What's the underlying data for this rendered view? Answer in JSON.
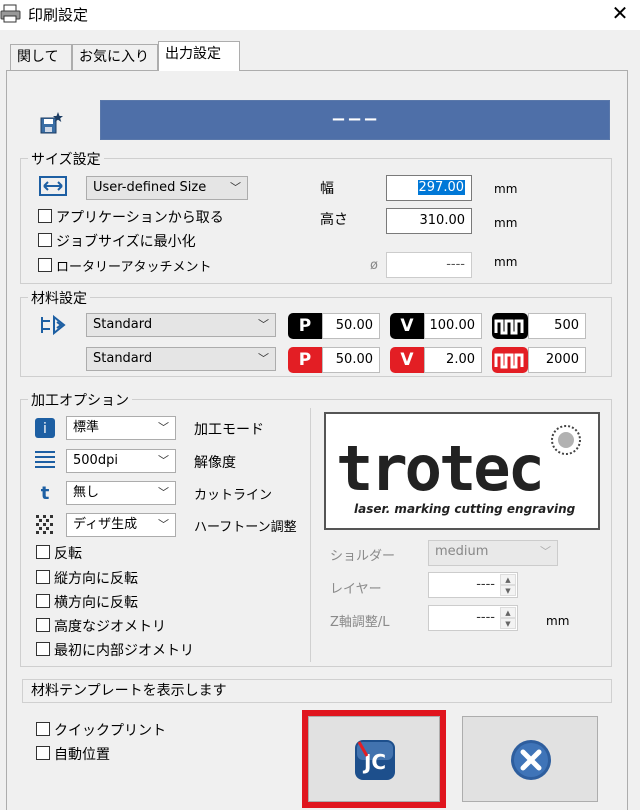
{
  "window": {
    "title": "印刷設定",
    "close_icon": "close-icon"
  },
  "tabs": [
    {
      "label": "関して"
    },
    {
      "label": "お気に入り"
    },
    {
      "label": "出力設定",
      "active": true
    }
  ],
  "banner": {
    "text": "−−−"
  },
  "size_group": {
    "title": "サイズ設定",
    "size_select": "User-defined Size",
    "width_label": "幅",
    "width_value": "297.00",
    "height_label": "高さ",
    "height_value": "310.00",
    "diameter_label": "ø",
    "diameter_value": "----",
    "unit": "mm",
    "checkboxes": [
      {
        "label": "アプリケーションから取る",
        "checked": false
      },
      {
        "label": "ジョブサイズに最小化",
        "checked": false
      },
      {
        "label": "ロータリーアタッチメント",
        "checked": false
      }
    ]
  },
  "material_group": {
    "title": "材料設定",
    "rows": [
      {
        "select": "Standard",
        "p": "50.00",
        "v": "100.00",
        "f": "500",
        "color": "#000000"
      },
      {
        "select": "Standard",
        "p": "50.00",
        "v": "2.00",
        "f": "2000",
        "color": "#e31e24"
      }
    ],
    "badge_p": "P",
    "badge_v": "V"
  },
  "options_group": {
    "title": "加工オプション",
    "rows": [
      {
        "value": "標準",
        "label": "加工モード"
      },
      {
        "value": "500dpi",
        "label": "解像度"
      },
      {
        "value": "無し",
        "label": "カットライン"
      },
      {
        "value": "ディザ生成",
        "label": "ハーフトーン調整"
      }
    ],
    "checkboxes": [
      {
        "label": "反転",
        "checked": false
      },
      {
        "label": "縦方向に反転",
        "checked": false
      },
      {
        "label": "横方向に反転",
        "checked": false
      },
      {
        "label": "高度なジオメトリ",
        "checked": false
      },
      {
        "label": "最初に内部ジオメトリ",
        "checked": false
      }
    ],
    "logo_word": "trotec",
    "logo_tagline": "laser. marking cutting engraving",
    "shoulder_label": "ショルダー",
    "shoulder_value": "medium",
    "layer_label": "レイヤー",
    "layer_value": "----",
    "zaxis_label": "Z軸調整/L",
    "zaxis_value": "----",
    "zaxis_unit": "mm"
  },
  "template_bar": {
    "label": "材料テンプレートを表示します"
  },
  "bottom": {
    "checkboxes": [
      {
        "label": "クイックプリント",
        "checked": false
      },
      {
        "label": "自動位置",
        "checked": false
      }
    ],
    "ok_icon": "jobcontrol-icon",
    "cancel_icon": "cancel-icon"
  },
  "colors": {
    "accent_blue": "#4e6fa8",
    "highlight": "#e0151e",
    "selection": "#0078d7"
  }
}
